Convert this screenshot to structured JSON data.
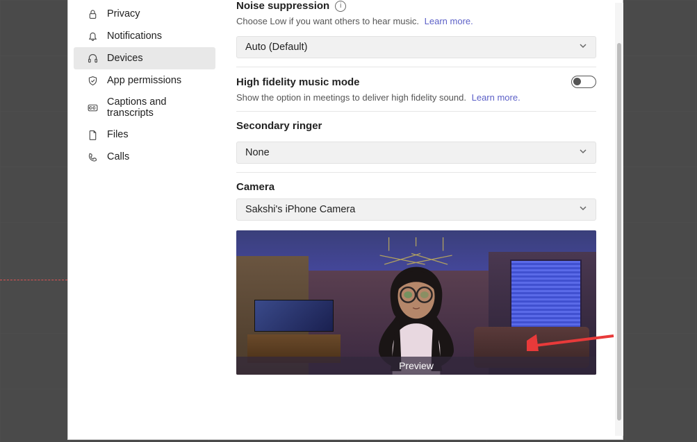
{
  "sidebar": {
    "items": [
      {
        "label": "Privacy"
      },
      {
        "label": "Notifications"
      },
      {
        "label": "Devices"
      },
      {
        "label": "App permissions"
      },
      {
        "label": "Captions and transcripts"
      },
      {
        "label": "Files"
      },
      {
        "label": "Calls"
      }
    ]
  },
  "noise_suppression": {
    "title": "Noise suppression",
    "description": "Choose Low if you want others to hear music.",
    "learn_more": "Learn more.",
    "value": "Auto (Default)"
  },
  "high_fidelity": {
    "title": "High fidelity music mode",
    "description": "Show the option in meetings to deliver high fidelity sound.",
    "learn_more": "Learn more."
  },
  "secondary_ringer": {
    "title": "Secondary ringer",
    "value": "None"
  },
  "camera": {
    "title": "Camera",
    "value": "Sakshi's iPhone Camera",
    "preview_label": "Preview"
  }
}
